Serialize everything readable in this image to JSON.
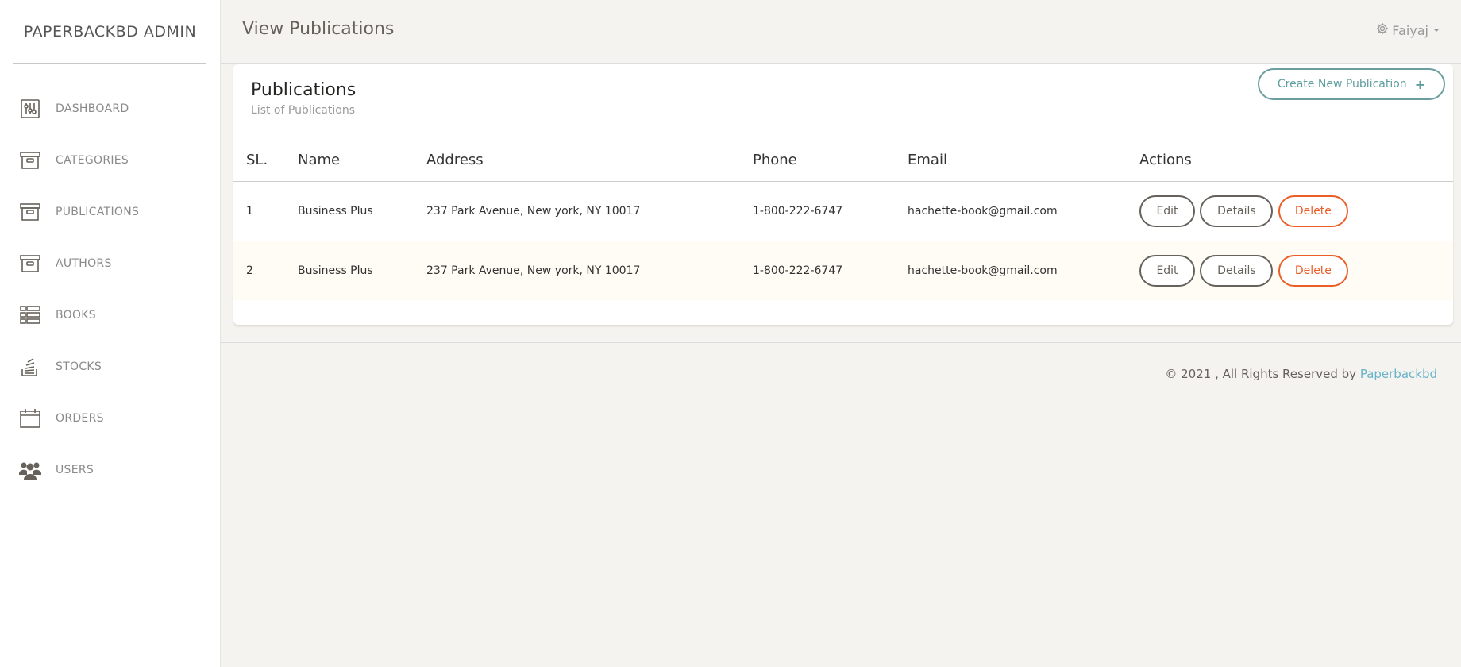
{
  "sidebar": {
    "brand": "PAPERBACKBD ADMIN",
    "items": [
      {
        "label": "DASHBOARD",
        "icon": "sliders-icon"
      },
      {
        "label": "CATEGORIES",
        "icon": "archive-icon"
      },
      {
        "label": "PUBLICATIONS",
        "icon": "archive-icon"
      },
      {
        "label": "AUTHORS",
        "icon": "archive-icon"
      },
      {
        "label": "BOOKS",
        "icon": "list-icon"
      },
      {
        "label": "STOCKS",
        "icon": "stack-icon"
      },
      {
        "label": "ORDERS",
        "icon": "calendar-icon"
      },
      {
        "label": "USERS",
        "icon": "users-icon"
      }
    ]
  },
  "header": {
    "title": "View Publications",
    "user": "Faiyaj"
  },
  "card": {
    "title": "Publications",
    "subtitle": "List of Publications",
    "create_label": "Create New Publication"
  },
  "table": {
    "columns": [
      "SL.",
      "Name",
      "Address",
      "Phone",
      "Email",
      "Actions"
    ],
    "rows": [
      {
        "sl": "1",
        "name": "Business Plus",
        "address": "237 Park Avenue, New york, NY 10017",
        "phone": "1-800-222-6747",
        "email": "hachette-book@gmail.com"
      },
      {
        "sl": "2",
        "name": "Business Plus",
        "address": "237 Park Avenue, New york, NY 10017",
        "phone": "1-800-222-6747",
        "email": "hachette-book@gmail.com"
      }
    ],
    "actions": {
      "edit": "Edit",
      "details": "Details",
      "delete": "Delete"
    }
  },
  "footer": {
    "text": "© 2021 , All Rights Reserved by",
    "link": "Paperbackbd"
  },
  "colors": {
    "background": "#f4f3ef",
    "accent_info": "#68b3c8",
    "danger": "#eb5e28",
    "text_muted": "#9a9a9a"
  }
}
